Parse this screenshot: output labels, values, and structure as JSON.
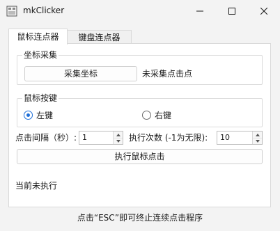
{
  "window": {
    "title": "mkClicker"
  },
  "tabs": [
    {
      "label": "鼠标连点器",
      "active": true
    },
    {
      "label": "键盘连点器",
      "active": false
    }
  ],
  "coord_group": {
    "legend": "坐标采集",
    "capture_button": "采集坐标",
    "status": "未采集点击点"
  },
  "mouse_button_group": {
    "legend": "鼠标按键",
    "left_label": "左键",
    "right_label": "右键",
    "selected": "left"
  },
  "interval": {
    "label": "点击间隔（秒）:",
    "value": "1"
  },
  "count": {
    "label": "执行次数 (-1为无限):",
    "value": "10"
  },
  "run_button": "执行鼠标点击",
  "run_status": "当前未执行",
  "footer": "点击“ESC”即可终止连续点击程序",
  "colors": {
    "accent": "#1e6fd9",
    "background": "#f3f3f3",
    "panel": "#ffffff"
  }
}
